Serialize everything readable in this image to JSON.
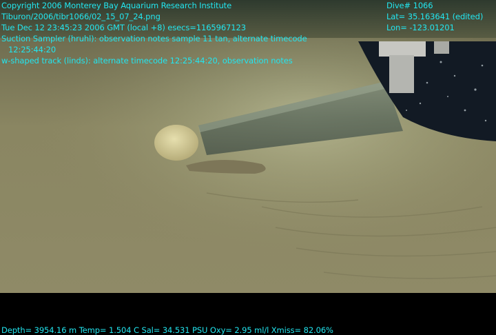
{
  "overlay_top_left": {
    "copyright": "Copyright 2006 Monterey Bay Aquarium Research Institute",
    "file_path": "Tiburon/2006/tibr1066/02_15_07_24.png",
    "datetime": "Tue Dec 12 23:45:23 2006 GMT (local +8)  esecs=1165967123",
    "annotation_1": "Suction Sampler (hruhl): observation notes sample 11 tan, alternate timecode",
    "annotation_1_time": "12:25:44:20",
    "annotation_2": "w-shaped track (linds): alternate timecode 12:25:44:20, observation notes"
  },
  "overlay_top_right": {
    "dive": "Dive# 1066",
    "lat": "Lat= 35.163641 (edited)",
    "lon": "Lon= -123.01201"
  },
  "overlay_bottom": {
    "telemetry": "Depth= 3954.16 m  Temp= 1.504 C  Sal= 34.531 PSU  Oxy= 2.95 ml/l  Xmiss= 82.06%"
  },
  "colors": {
    "overlay_text": "#22e6f0",
    "seafloor": "#8f8a66",
    "background": "#000000"
  }
}
